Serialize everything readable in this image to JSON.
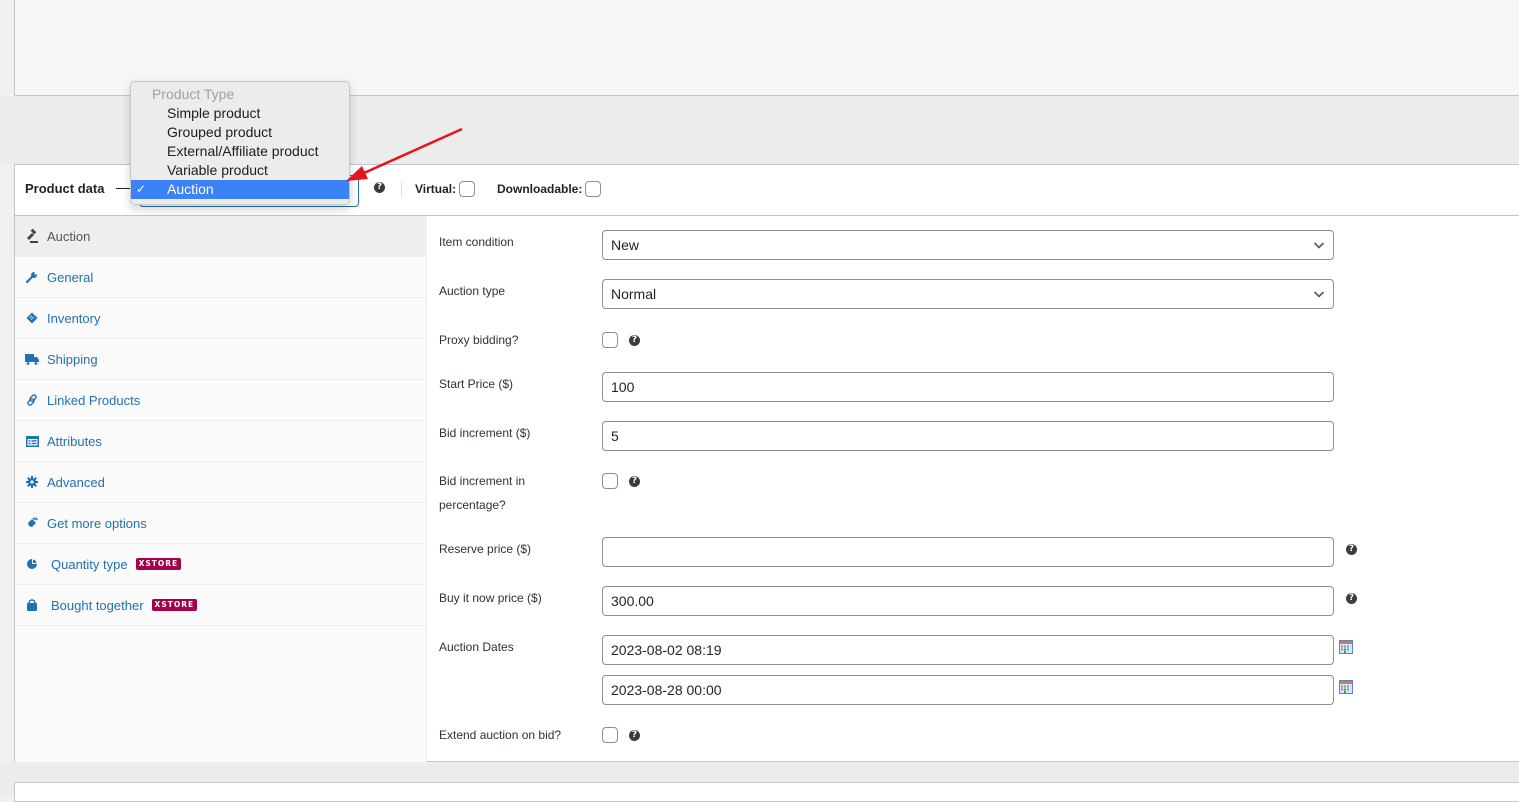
{
  "product_data": {
    "title": "Product data",
    "product_type_selected": "Auction",
    "virtual_label": "Virtual:",
    "virtual_checked": false,
    "downloadable_label": "Downloadable:",
    "downloadable_checked": false
  },
  "dropdown": {
    "header": "Product Type",
    "options": [
      {
        "label": "Simple product",
        "selected": false
      },
      {
        "label": "Grouped product",
        "selected": false
      },
      {
        "label": "External/Affiliate product",
        "selected": false
      },
      {
        "label": "Variable product",
        "selected": false
      },
      {
        "label": "Auction",
        "selected": true
      }
    ],
    "check_glyph": "✓"
  },
  "tabs": [
    {
      "label": "Auction",
      "icon": "gavel-icon",
      "active": true
    },
    {
      "label": "General",
      "icon": "wrench-icon",
      "active": false
    },
    {
      "label": "Inventory",
      "icon": "tag-icon",
      "active": false
    },
    {
      "label": "Shipping",
      "icon": "truck-icon",
      "active": false
    },
    {
      "label": "Linked Products",
      "icon": "link-icon",
      "active": false
    },
    {
      "label": "Attributes",
      "icon": "list-icon",
      "active": false
    },
    {
      "label": "Advanced",
      "icon": "gear-icon",
      "active": false
    },
    {
      "label": "Get more options",
      "icon": "plugin-icon",
      "active": false
    },
    {
      "label": "Quantity type",
      "icon": "pie-icon",
      "active": false,
      "badge": "XSTORE"
    },
    {
      "label": "Bought together",
      "icon": "bag-icon",
      "active": false,
      "badge": "XSTORE"
    }
  ],
  "fields": {
    "item_condition": {
      "label": "Item condition",
      "value": "New"
    },
    "auction_type": {
      "label": "Auction type",
      "value": "Normal"
    },
    "proxy_bidding": {
      "label": "Proxy bidding?",
      "checked": false
    },
    "start_price": {
      "label": "Start Price ($)",
      "value": "100"
    },
    "bid_increment": {
      "label": "Bid increment ($)",
      "value": "5"
    },
    "bid_increment_pct": {
      "label_line1": "Bid increment in",
      "label_line2": "percentage?",
      "checked": false
    },
    "reserve_price": {
      "label": "Reserve price ($)",
      "value": ""
    },
    "buy_now_price": {
      "label": "Buy it now price ($)",
      "value": "300.00"
    },
    "auction_dates": {
      "label": "Auction Dates",
      "start": "2023-08-02 08:19",
      "end": "2023-08-28 00:00"
    },
    "extend_auction": {
      "label": "Extend auction on bid?",
      "checked": false
    }
  },
  "help_glyph": "?",
  "colors": {
    "link": "#2271b1",
    "badge": "#a5004a",
    "selected_option": "#3b82f7",
    "annotation_arrow": "#e8141c"
  }
}
